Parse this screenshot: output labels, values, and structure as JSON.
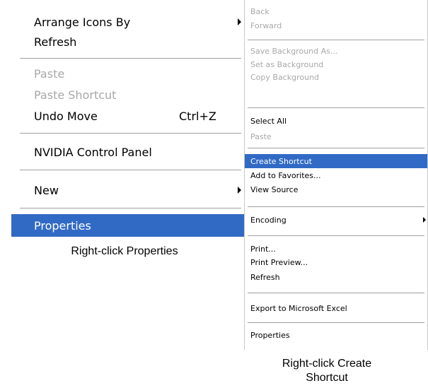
{
  "desktop_menu": {
    "arrange_icons_by": "Arrange Icons By",
    "refresh": "Refresh",
    "paste": "Paste",
    "paste_shortcut": "Paste Shortcut",
    "undo_move": "Undo Move",
    "undo_shortcut": "Ctrl+Z",
    "nvidia_control_panel": "NVIDIA Control Panel",
    "new": "New",
    "properties": "Properties"
  },
  "caption_left": "Right-click Properties",
  "browser_menu": {
    "back": "Back",
    "forward": "Forward",
    "save_background_as": "Save Background As...",
    "set_as_background": "Set as Background",
    "copy_background": "Copy Background",
    "select_all": "Select All",
    "paste": "Paste",
    "create_shortcut": "Create Shortcut",
    "add_to_favorites": "Add to Favorites...",
    "view_source": "View Source",
    "encoding": "Encoding",
    "print": "Print...",
    "print_preview": "Print Preview...",
    "refresh": "Refresh",
    "export_to_excel": "Export to Microsoft Excel",
    "properties": "Properties"
  },
  "caption_right_line1": "Right-click Create",
  "caption_right_line2": "Shortcut",
  "colors": {
    "highlight": "#316ac5",
    "disabled_text": "#a8a8a8"
  }
}
